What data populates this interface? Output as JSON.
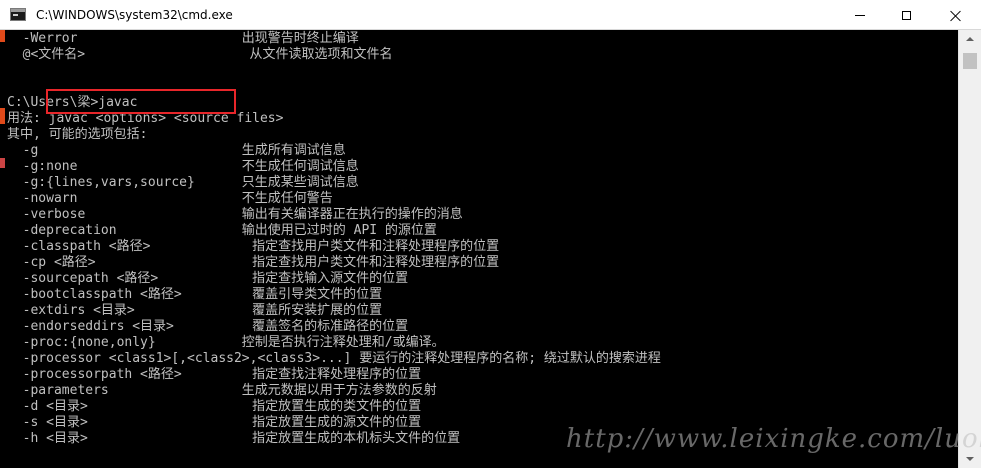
{
  "window": {
    "title": "C:\\WINDOWS\\system32\\cmd.exe",
    "icon": "cmd-icon",
    "controls": {
      "minimize_icon": "minimize-icon",
      "maximize_icon": "maximize-icon",
      "close_icon": "close-icon"
    }
  },
  "console": {
    "text_color": "#c0c0c0",
    "background": "#000000",
    "lines": [
      "  -Werror                     出现警告时终止编译",
      "  @<文件名>                     从文件读取选项和文件名",
      "",
      "",
      "C:\\Users\\梁>javac",
      "用法: javac <options> <source files>",
      "其中, 可能的选项包括:",
      "  -g                          生成所有调试信息",
      "  -g:none                     不生成任何调试信息",
      "  -g:{lines,vars,source}      只生成某些调试信息",
      "  -nowarn                     不生成任何警告",
      "  -verbose                    输出有关编译器正在执行的操作的消息",
      "  -deprecation                输出使用已过时的 API 的源位置",
      "  -classpath <路径>             指定查找用户类文件和注释处理程序的位置",
      "  -cp <路径>                    指定查找用户类文件和注释处理程序的位置",
      "  -sourcepath <路径>            指定查找输入源文件的位置",
      "  -bootclasspath <路径>         覆盖引导类文件的位置",
      "  -extdirs <目录>               覆盖所安装扩展的位置",
      "  -endorseddirs <目录>          覆盖签名的标准路径的位置",
      "  -proc:{none,only}           控制是否执行注释处理和/或编译。",
      "  -processor <class1>[,<class2>,<class3>...] 要运行的注释处理程序的名称; 绕过默认的搜索进程",
      "  -processorpath <路径>         指定查找注释处理程序的位置",
      "  -parameters                 生成元数据以用于方法参数的反射",
      "  -d <目录>                     指定放置生成的类文件的位置",
      "  -s <目录>                     指定放置生成的源文件的位置",
      "  -h <目录>                     指定放置生成的本机标头文件的位置"
    ]
  },
  "annotation": {
    "color": "#e8262a"
  },
  "watermark": {
    "text": "http://www.leixingke.com/luolei"
  },
  "scrollbar": {
    "up_icon": "scroll-up-arrow-icon",
    "down_icon": "scroll-down-arrow-icon"
  }
}
